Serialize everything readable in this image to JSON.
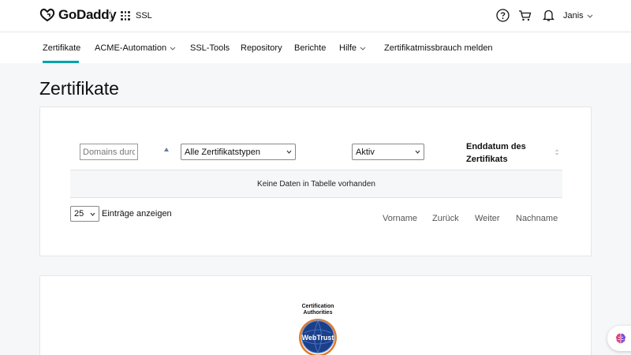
{
  "header": {
    "brand": "GoDaddy",
    "product": "SSL",
    "user": "Janis"
  },
  "nav": {
    "items": [
      {
        "label": "Zertifikate",
        "active": true
      },
      {
        "label": "ACME-Automation",
        "dropdown": true
      },
      {
        "label": "SSL-Tools"
      },
      {
        "label": "Repository"
      },
      {
        "label": "Berichte"
      },
      {
        "label": "Hilfe",
        "dropdown": true
      },
      {
        "label": "Zertifikatmissbrauch melden"
      }
    ]
  },
  "page": {
    "title": "Zertifikate"
  },
  "table": {
    "domains_placeholder": "Domains durchsuchen",
    "type_filter": "Alle Zertifikatstypen",
    "status_filter": "Aktiv",
    "end_date_header": "Enddatum des Zertifikats",
    "empty_message": "Keine Daten in Tabelle vorhanden",
    "page_length": "25",
    "page_length_label": "Einträge anzeigen",
    "pager": {
      "first": "Vorname",
      "prev": "Zurück",
      "next": "Weiter",
      "last": "Nachname"
    }
  },
  "badge": {
    "line1": "Certification",
    "line2": "Authorities",
    "seal_text": "WebTrust"
  },
  "colors": {
    "accent": "#00a4a6",
    "seal_blue": "#1c3f8a",
    "seal_ring": "#e07b2a"
  }
}
